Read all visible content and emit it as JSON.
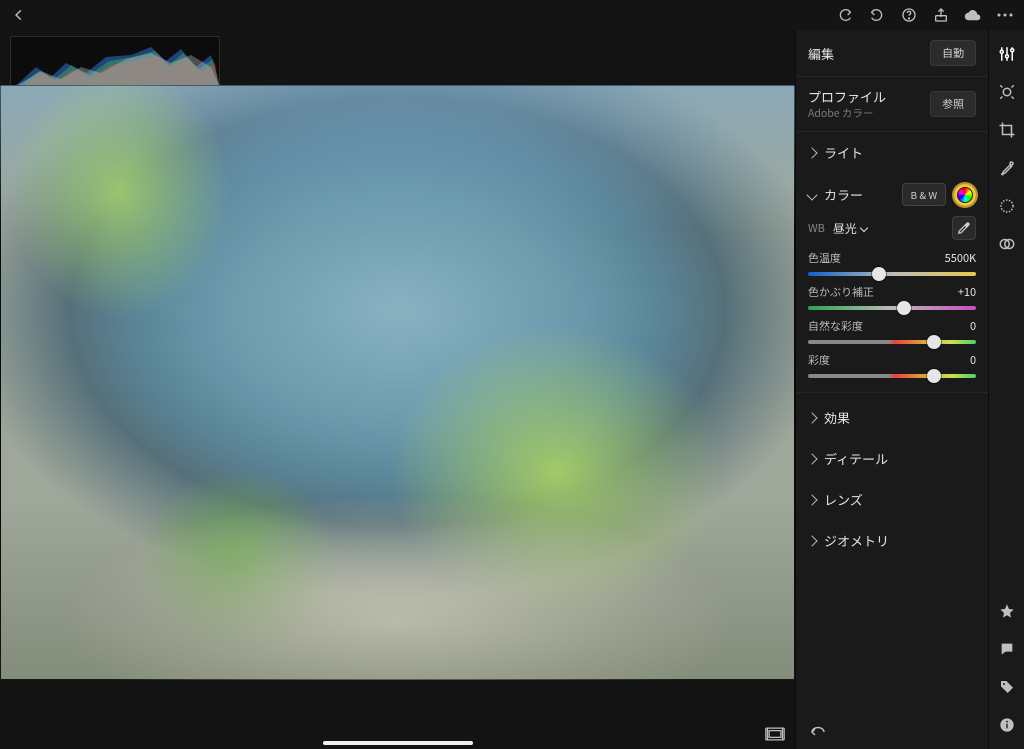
{
  "topbar": {
    "icons": {
      "back": "back-icon",
      "redo": "redo-icon",
      "undo": "undo-icon",
      "help": "help-icon",
      "share": "share-icon",
      "cloud": "cloud-icon",
      "more": "more-icon"
    }
  },
  "panel": {
    "edit_label": "編集",
    "auto_label": "自動",
    "profile_label": "プロファイル",
    "profile_value": "Adobe カラー",
    "browse_label": "参照",
    "sections": {
      "light": "ライト",
      "color": "カラー",
      "effect": "効果",
      "detail": "ディテール",
      "lens": "レンズ",
      "geometry": "ジオメトリ"
    },
    "color": {
      "bw_label": "B & W",
      "wb_short": "WB",
      "wb_value": "昼光",
      "sliders": {
        "temperature": {
          "label": "色温度",
          "value": "5500K",
          "pos": 42
        },
        "tint": {
          "label": "色かぶり補正",
          "value": "+10",
          "pos": 57
        },
        "vibrance": {
          "label": "自然な彩度",
          "value": "0",
          "pos": 75
        },
        "saturation": {
          "label": "彩度",
          "value": "0",
          "pos": 75
        }
      }
    }
  },
  "toolbar": {
    "tools": [
      "adjust-icon",
      "heal-icon",
      "crop-icon",
      "brush-icon",
      "radial-icon",
      "masking-icon"
    ],
    "bottom": [
      "star-icon",
      "comment-icon",
      "tag-icon",
      "info-icon"
    ]
  },
  "canvas": {
    "filmstrip_icon": "filmstrip-icon",
    "reset_icon": "reset-icon"
  }
}
